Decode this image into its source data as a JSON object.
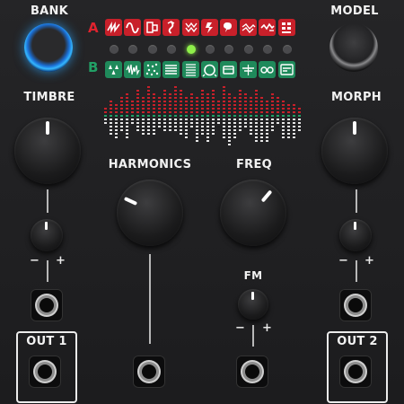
{
  "module": {
    "bank_label": "BANK",
    "model_label": "MODEL",
    "bank_a_letter": "A",
    "bank_b_letter": "B",
    "active_model_index": 4,
    "colors": {
      "bank_a": "#c8202a",
      "bank_b": "#1f8a5b",
      "led_on": "#8ff04a",
      "led_off": "#4a4a4d",
      "bank_button_glow": "#2fa8ff"
    }
  },
  "bank_a_icons": [
    "pair-ramp-icon",
    "sine-wave-icon",
    "waveshape-icon",
    "fm-icon",
    "grain-icon",
    "additive-icon",
    "wavetable-icon",
    "chord-icon",
    "speech-icon",
    "swarm-icon"
  ],
  "bank_b_icons": [
    "drops-icon",
    "noise-icon",
    "particle-icon",
    "string-icon",
    "modal-icon",
    "bass-drum-icon",
    "snare-drum-icon",
    "hihat-icon",
    "chord-b-icon",
    "analog-icon"
  ],
  "knobs": {
    "timbre_label": "TIMBRE",
    "morph_label": "MORPH",
    "harmonics_label": "HARMONICS",
    "freq_label": "FREQ",
    "fm_label": "FM"
  },
  "attenuverters": {
    "minus": "−",
    "plus": "+"
  },
  "outputs": {
    "out1_label": "OUT 1",
    "out2_label": "OUT 2"
  }
}
